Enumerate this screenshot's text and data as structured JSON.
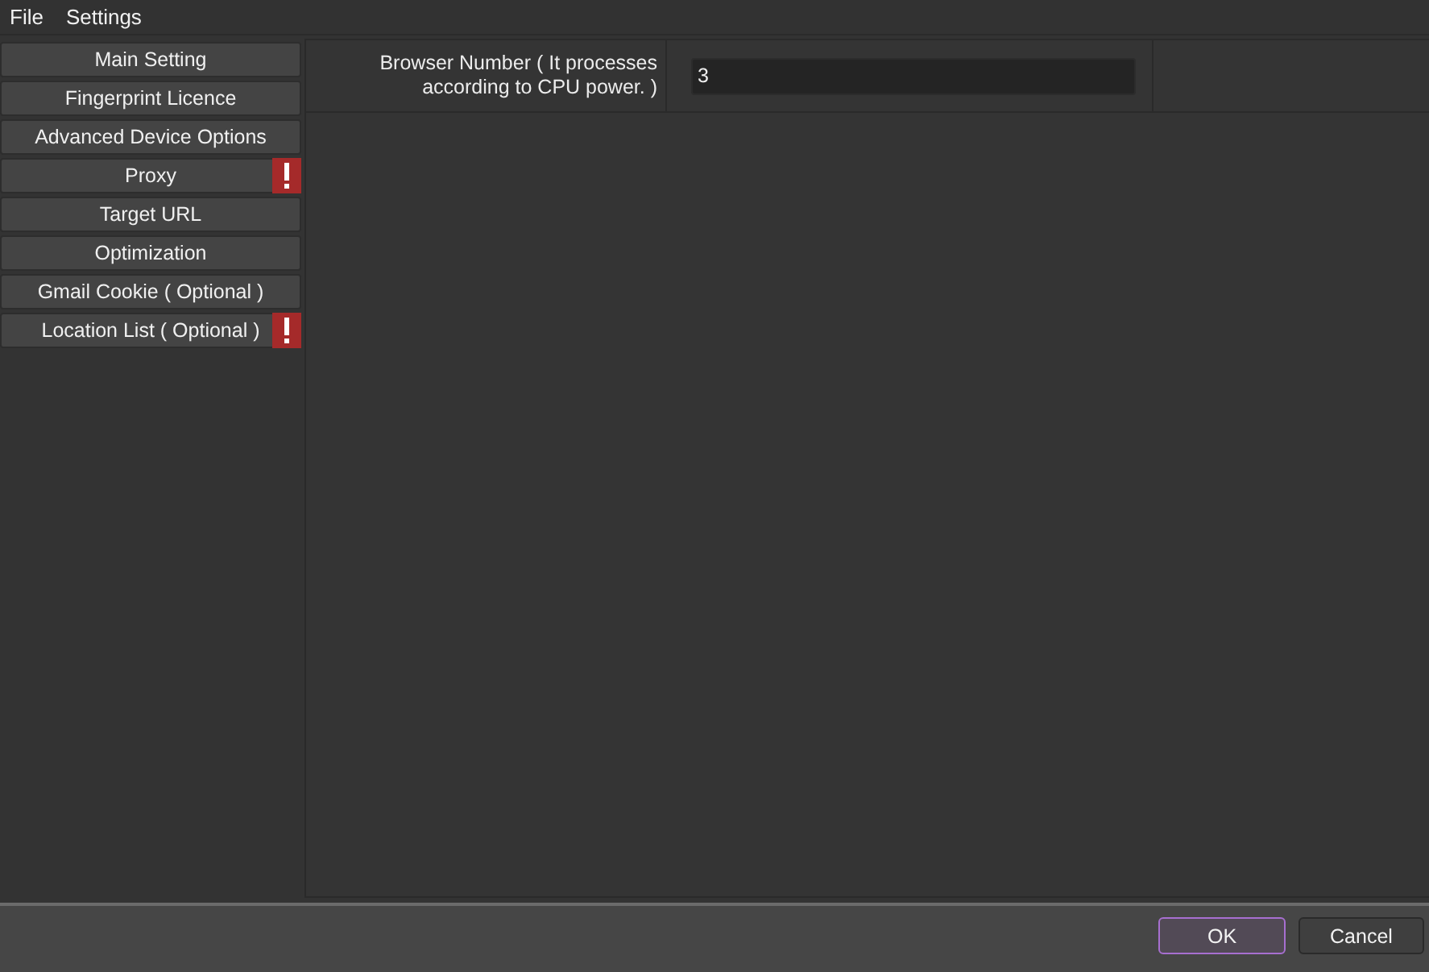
{
  "menu_bar": {
    "items": [
      "File",
      "Settings"
    ]
  },
  "sidebar": {
    "items": [
      {
        "label": "Main Setting",
        "warning": false
      },
      {
        "label": "Fingerprint Licence",
        "warning": false
      },
      {
        "label": "Advanced Device Options",
        "warning": false
      },
      {
        "label": "Proxy",
        "warning": true
      },
      {
        "label": "Target URL",
        "warning": false
      },
      {
        "label": "Optimization",
        "warning": false
      },
      {
        "label": "Gmail Cookie ( Optional )",
        "warning": false
      },
      {
        "label": "Location List ( Optional )",
        "warning": true
      }
    ]
  },
  "settings_table": {
    "rows": [
      {
        "label": "Browser Number ( It processes according to CPU power. )",
        "value": "3"
      }
    ]
  },
  "buttons": [
    {
      "label": "OK",
      "default": true
    },
    {
      "label": "Cancel",
      "default": false
    }
  ]
}
